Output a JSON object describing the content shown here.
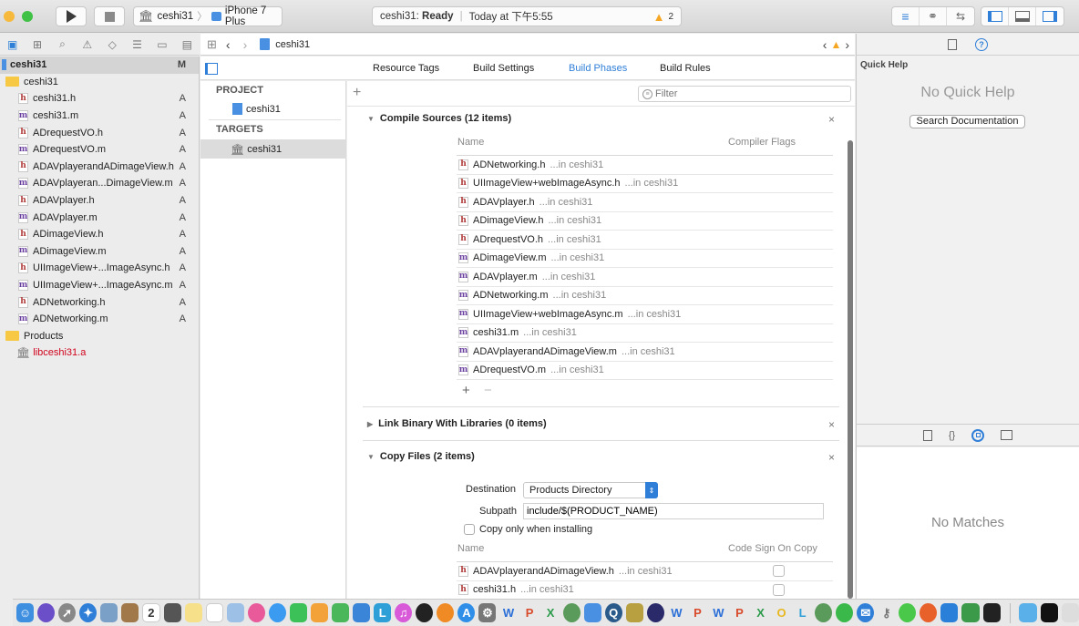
{
  "toolbar": {
    "scheme": "ceshi31",
    "device": "iPhone 7 Plus",
    "activity_project": "ceshi31:",
    "activity_status": "Ready",
    "activity_time": "Today at 下午5:55",
    "warning_count": "2"
  },
  "navigator": {
    "project": {
      "name": "ceshi31",
      "status": "M"
    },
    "group": "ceshi31",
    "files": [
      {
        "name": "ceshi31.h",
        "type": "h",
        "status": "A"
      },
      {
        "name": "ceshi31.m",
        "type": "m",
        "status": "A"
      },
      {
        "name": "ADrequestVO.h",
        "type": "h",
        "status": "A"
      },
      {
        "name": "ADrequestVO.m",
        "type": "m",
        "status": "A"
      },
      {
        "name": "ADAVplayerandADimageView.h",
        "type": "h",
        "status": "A"
      },
      {
        "name": "ADAVplayeran...DimageView.m",
        "type": "m",
        "status": "A"
      },
      {
        "name": "ADAVplayer.h",
        "type": "h",
        "status": "A"
      },
      {
        "name": "ADAVplayer.m",
        "type": "m",
        "status": "A"
      },
      {
        "name": "ADimageView.h",
        "type": "h",
        "status": "A"
      },
      {
        "name": "ADimageView.m",
        "type": "m",
        "status": "A"
      },
      {
        "name": "UIImageView+...ImageAsync.h",
        "type": "h",
        "status": "A"
      },
      {
        "name": "UIImageView+...ImageAsync.m",
        "type": "m",
        "status": "A"
      },
      {
        "name": "ADNetworking.h",
        "type": "h",
        "status": "A"
      },
      {
        "name": "ADNetworking.m",
        "type": "m",
        "status": "A"
      }
    ],
    "products_group": "Products",
    "product": "libceshi31.a"
  },
  "jumpbar": {
    "item": "ceshi31"
  },
  "tabs": [
    "Resource Tags",
    "Build Settings",
    "Build Phases",
    "Build Rules"
  ],
  "active_tab": "Build Phases",
  "targets_panel": {
    "project_header": "PROJECT",
    "project_name": "ceshi31",
    "targets_header": "TARGETS",
    "target_name": "ceshi31"
  },
  "filter_placeholder": "Filter",
  "compile_sources": {
    "title": "Compile Sources (12 items)",
    "col_name": "Name",
    "col_flags": "Compiler Flags",
    "suffix": "...in ceshi31",
    "files": [
      {
        "name": "ADNetworking.h",
        "type": "h"
      },
      {
        "name": "UIImageView+webImageAsync.h",
        "type": "h"
      },
      {
        "name": "ADAVplayer.h",
        "type": "h"
      },
      {
        "name": "ADimageView.h",
        "type": "h"
      },
      {
        "name": "ADrequestVO.h",
        "type": "h"
      },
      {
        "name": "ADimageView.m",
        "type": "m"
      },
      {
        "name": "ADAVplayer.m",
        "type": "m"
      },
      {
        "name": "ADNetworking.m",
        "type": "m"
      },
      {
        "name": "UIImageView+webImageAsync.m",
        "type": "m"
      },
      {
        "name": "ceshi31.m",
        "type": "m"
      },
      {
        "name": "ADAVplayerandADimageView.m",
        "type": "m"
      },
      {
        "name": "ADrequestVO.m",
        "type": "m"
      }
    ]
  },
  "link_binary": {
    "title": "Link Binary With Libraries (0 items)"
  },
  "copy_files": {
    "title": "Copy Files (2 items)",
    "destination_label": "Destination",
    "destination_value": "Products Directory",
    "subpath_label": "Subpath",
    "subpath_value": "include/$(PRODUCT_NAME)",
    "copy_only_label": "Copy only when installing",
    "copy_only_checked": false,
    "col_name": "Name",
    "col_sign": "Code Sign On Copy",
    "suffix": "...in ceshi31",
    "files": [
      {
        "name": "ADAVplayerandADimageView.h",
        "type": "h",
        "code_sign": false
      },
      {
        "name": "ceshi31.h",
        "type": "h",
        "code_sign": false
      }
    ]
  },
  "inspector": {
    "title": "Quick Help",
    "no_help": "No Quick Help",
    "search_button": "Search Documentation",
    "no_matches": "No Matches"
  },
  "colors": {
    "accent": "#2f7fd8",
    "warning": "#f5a623",
    "product_red": "#d0021b"
  }
}
